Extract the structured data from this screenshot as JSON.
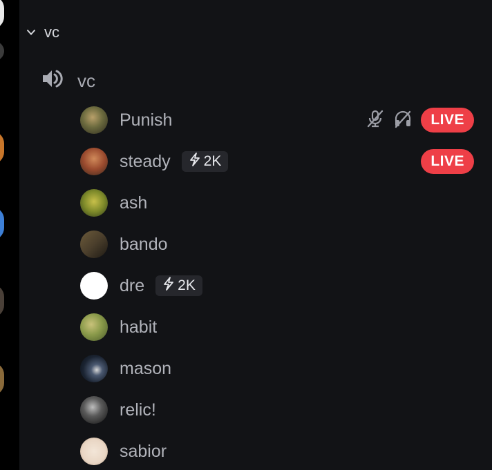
{
  "category": {
    "name": "vc"
  },
  "voice_channel": {
    "name": "vc"
  },
  "users": [
    {
      "name": "Punish",
      "boost": null,
      "muted": true,
      "deafened": true,
      "live": "LIVE",
      "avatar_color": "#6b6a3e"
    },
    {
      "name": "steady",
      "boost": "2K",
      "muted": false,
      "deafened": false,
      "live": "LIVE",
      "avatar_color": "#9a4a2e"
    },
    {
      "name": "ash",
      "boost": null,
      "muted": false,
      "deafened": false,
      "live": null,
      "avatar_color": "#7e8a2a"
    },
    {
      "name": "bando",
      "boost": null,
      "muted": false,
      "deafened": false,
      "live": null,
      "avatar_color": "#4b3f2c"
    },
    {
      "name": "dre",
      "boost": "2K",
      "muted": false,
      "deafened": false,
      "live": null,
      "avatar_color": "#ffffff"
    },
    {
      "name": "habit",
      "boost": null,
      "muted": false,
      "deafened": false,
      "live": null,
      "avatar_color": "#8a9a4a"
    },
    {
      "name": "mason",
      "boost": null,
      "muted": false,
      "deafened": false,
      "live": null,
      "avatar_color": "#1b2432"
    },
    {
      "name": "relic!",
      "boost": null,
      "muted": false,
      "deafened": false,
      "live": null,
      "avatar_color": "#3a3a3a"
    },
    {
      "name": "sabior",
      "boost": null,
      "muted": false,
      "deafened": false,
      "live": null,
      "avatar_color": "#e9d6c4"
    }
  ],
  "colors": {
    "live_red": "#ee3f47",
    "username": "#b1b3ba",
    "panel_bg": "#121316",
    "badge_bg": "#26272c"
  },
  "icons": {
    "category_toggle": "chevron-down-icon",
    "voice_channel": "speaker-icon",
    "boost": "lightning-icon",
    "mute": "microphone-muted-icon",
    "deafen": "headphones-deafened-icon"
  }
}
